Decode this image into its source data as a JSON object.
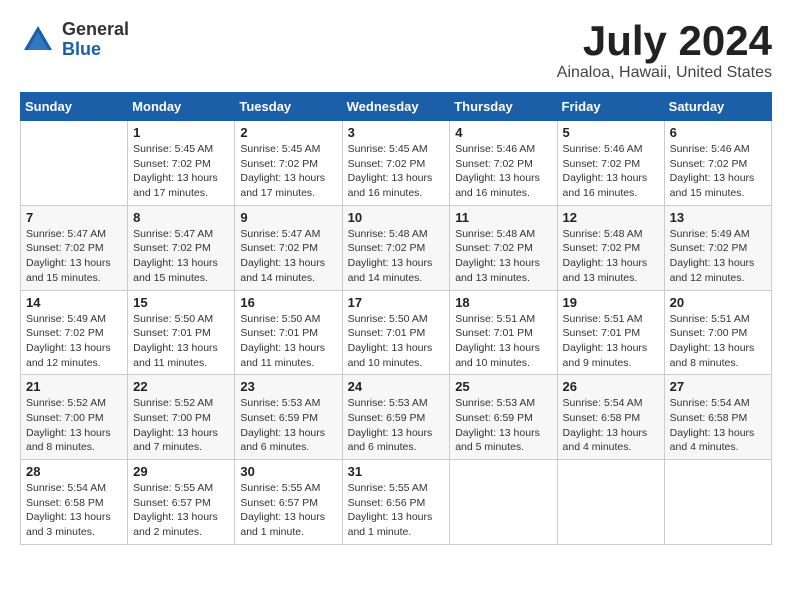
{
  "header": {
    "logo_general": "General",
    "logo_blue": "Blue",
    "title": "July 2024",
    "location": "Ainaloa, Hawaii, United States"
  },
  "days_of_week": [
    "Sunday",
    "Monday",
    "Tuesday",
    "Wednesday",
    "Thursday",
    "Friday",
    "Saturday"
  ],
  "weeks": [
    [
      {
        "day": "",
        "info": ""
      },
      {
        "day": "1",
        "info": "Sunrise: 5:45 AM\nSunset: 7:02 PM\nDaylight: 13 hours\nand 17 minutes."
      },
      {
        "day": "2",
        "info": "Sunrise: 5:45 AM\nSunset: 7:02 PM\nDaylight: 13 hours\nand 17 minutes."
      },
      {
        "day": "3",
        "info": "Sunrise: 5:45 AM\nSunset: 7:02 PM\nDaylight: 13 hours\nand 16 minutes."
      },
      {
        "day": "4",
        "info": "Sunrise: 5:46 AM\nSunset: 7:02 PM\nDaylight: 13 hours\nand 16 minutes."
      },
      {
        "day": "5",
        "info": "Sunrise: 5:46 AM\nSunset: 7:02 PM\nDaylight: 13 hours\nand 16 minutes."
      },
      {
        "day": "6",
        "info": "Sunrise: 5:46 AM\nSunset: 7:02 PM\nDaylight: 13 hours\nand 15 minutes."
      }
    ],
    [
      {
        "day": "7",
        "info": "Sunrise: 5:47 AM\nSunset: 7:02 PM\nDaylight: 13 hours\nand 15 minutes."
      },
      {
        "day": "8",
        "info": "Sunrise: 5:47 AM\nSunset: 7:02 PM\nDaylight: 13 hours\nand 15 minutes."
      },
      {
        "day": "9",
        "info": "Sunrise: 5:47 AM\nSunset: 7:02 PM\nDaylight: 13 hours\nand 14 minutes."
      },
      {
        "day": "10",
        "info": "Sunrise: 5:48 AM\nSunset: 7:02 PM\nDaylight: 13 hours\nand 14 minutes."
      },
      {
        "day": "11",
        "info": "Sunrise: 5:48 AM\nSunset: 7:02 PM\nDaylight: 13 hours\nand 13 minutes."
      },
      {
        "day": "12",
        "info": "Sunrise: 5:48 AM\nSunset: 7:02 PM\nDaylight: 13 hours\nand 13 minutes."
      },
      {
        "day": "13",
        "info": "Sunrise: 5:49 AM\nSunset: 7:02 PM\nDaylight: 13 hours\nand 12 minutes."
      }
    ],
    [
      {
        "day": "14",
        "info": "Sunrise: 5:49 AM\nSunset: 7:02 PM\nDaylight: 13 hours\nand 12 minutes."
      },
      {
        "day": "15",
        "info": "Sunrise: 5:50 AM\nSunset: 7:01 PM\nDaylight: 13 hours\nand 11 minutes."
      },
      {
        "day": "16",
        "info": "Sunrise: 5:50 AM\nSunset: 7:01 PM\nDaylight: 13 hours\nand 11 minutes."
      },
      {
        "day": "17",
        "info": "Sunrise: 5:50 AM\nSunset: 7:01 PM\nDaylight: 13 hours\nand 10 minutes."
      },
      {
        "day": "18",
        "info": "Sunrise: 5:51 AM\nSunset: 7:01 PM\nDaylight: 13 hours\nand 10 minutes."
      },
      {
        "day": "19",
        "info": "Sunrise: 5:51 AM\nSunset: 7:01 PM\nDaylight: 13 hours\nand 9 minutes."
      },
      {
        "day": "20",
        "info": "Sunrise: 5:51 AM\nSunset: 7:00 PM\nDaylight: 13 hours\nand 8 minutes."
      }
    ],
    [
      {
        "day": "21",
        "info": "Sunrise: 5:52 AM\nSunset: 7:00 PM\nDaylight: 13 hours\nand 8 minutes."
      },
      {
        "day": "22",
        "info": "Sunrise: 5:52 AM\nSunset: 7:00 PM\nDaylight: 13 hours\nand 7 minutes."
      },
      {
        "day": "23",
        "info": "Sunrise: 5:53 AM\nSunset: 6:59 PM\nDaylight: 13 hours\nand 6 minutes."
      },
      {
        "day": "24",
        "info": "Sunrise: 5:53 AM\nSunset: 6:59 PM\nDaylight: 13 hours\nand 6 minutes."
      },
      {
        "day": "25",
        "info": "Sunrise: 5:53 AM\nSunset: 6:59 PM\nDaylight: 13 hours\nand 5 minutes."
      },
      {
        "day": "26",
        "info": "Sunrise: 5:54 AM\nSunset: 6:58 PM\nDaylight: 13 hours\nand 4 minutes."
      },
      {
        "day": "27",
        "info": "Sunrise: 5:54 AM\nSunset: 6:58 PM\nDaylight: 13 hours\nand 4 minutes."
      }
    ],
    [
      {
        "day": "28",
        "info": "Sunrise: 5:54 AM\nSunset: 6:58 PM\nDaylight: 13 hours\nand 3 minutes."
      },
      {
        "day": "29",
        "info": "Sunrise: 5:55 AM\nSunset: 6:57 PM\nDaylight: 13 hours\nand 2 minutes."
      },
      {
        "day": "30",
        "info": "Sunrise: 5:55 AM\nSunset: 6:57 PM\nDaylight: 13 hours\nand 1 minute."
      },
      {
        "day": "31",
        "info": "Sunrise: 5:55 AM\nSunset: 6:56 PM\nDaylight: 13 hours\nand 1 minute."
      },
      {
        "day": "",
        "info": ""
      },
      {
        "day": "",
        "info": ""
      },
      {
        "day": "",
        "info": ""
      }
    ]
  ]
}
